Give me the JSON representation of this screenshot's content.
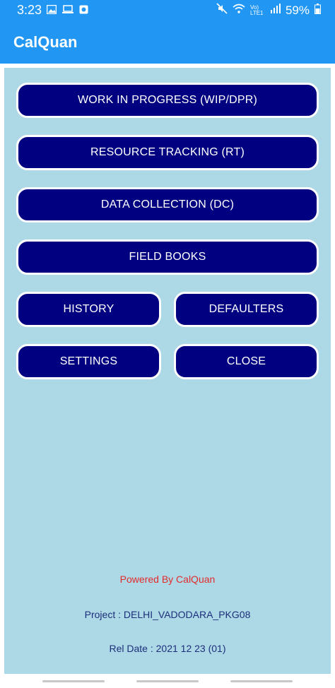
{
  "status_bar": {
    "time": "3:23",
    "battery": "59%",
    "network": "Vo) LTE1",
    "icons": [
      "image-icon",
      "laptop-icon",
      "app-notification-icon",
      "mute-icon",
      "wifi-icon",
      "signal-icon",
      "battery-icon"
    ]
  },
  "app_bar": {
    "title": "CalQuan"
  },
  "menu": {
    "wip": "WORK IN PROGRESS (WIP/DPR)",
    "rt": "RESOURCE TRACKING (RT)",
    "dc": "DATA COLLECTION (DC)",
    "field_books": "FIELD BOOKS",
    "history": "HISTORY",
    "defaulters": "DEFAULTERS",
    "settings": "SETTINGS",
    "close": "CLOSE"
  },
  "footer": {
    "powered_by": "Powered By CalQuan",
    "project": "Project : DELHI_VADODARA_PKG08",
    "rel_date": "Rel Date : 2021 12 23 (01)"
  },
  "colors": {
    "primary": "#2196F3",
    "background": "#ADD8E6",
    "button": "#000080",
    "powered_text": "#E32B2B",
    "info_text": "#1C2F7A"
  }
}
